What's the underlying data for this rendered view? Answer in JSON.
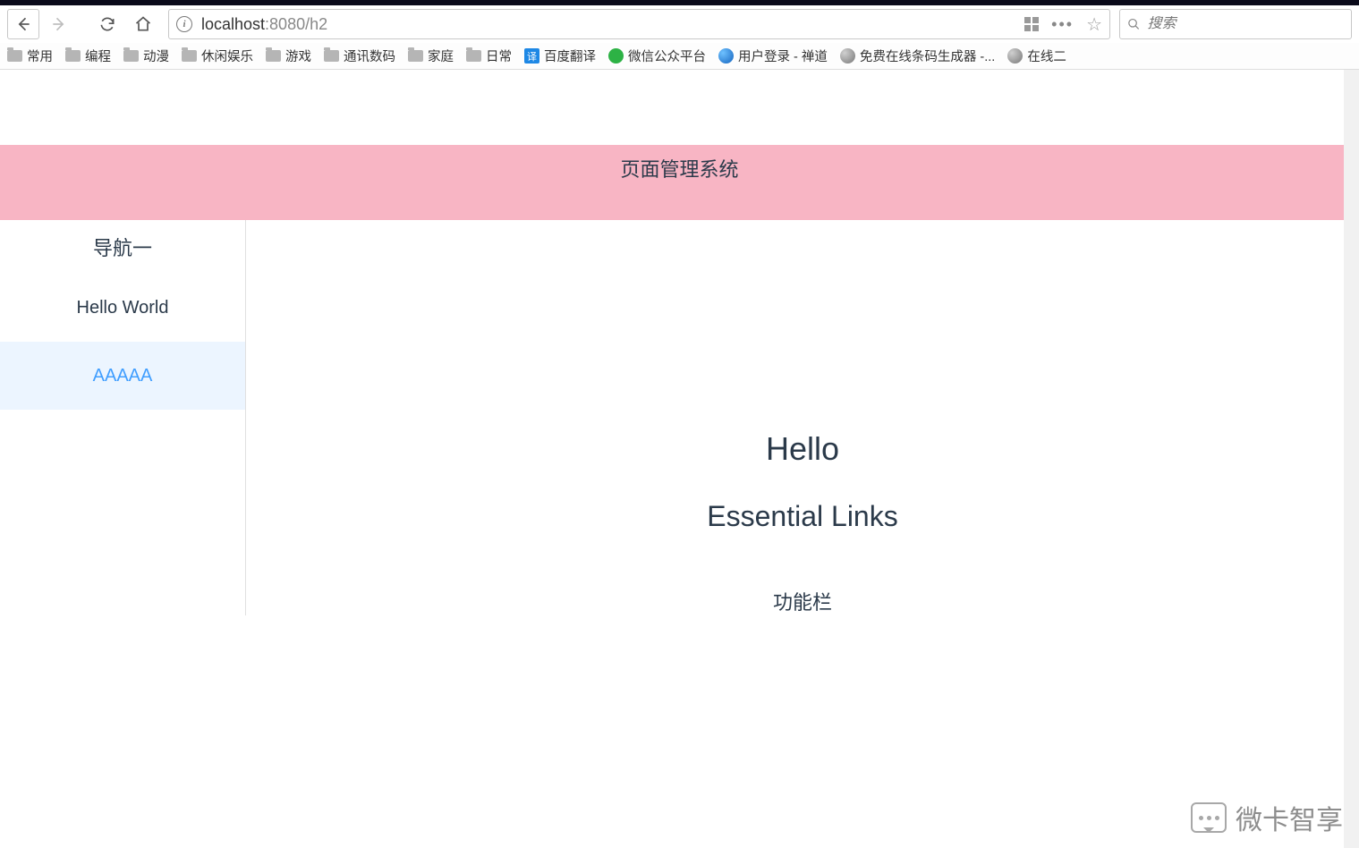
{
  "browser": {
    "url": {
      "host": "localhost",
      "port_path": ":8080/h2"
    },
    "search_placeholder": "搜索",
    "bookmarks": [
      {
        "kind": "folder",
        "label": "常用"
      },
      {
        "kind": "folder",
        "label": "编程"
      },
      {
        "kind": "folder",
        "label": "动漫"
      },
      {
        "kind": "folder",
        "label": "休闲娱乐"
      },
      {
        "kind": "folder",
        "label": "游戏"
      },
      {
        "kind": "folder",
        "label": "通讯数码"
      },
      {
        "kind": "folder",
        "label": "家庭"
      },
      {
        "kind": "folder",
        "label": "日常"
      },
      {
        "kind": "fav-blue",
        "label": "百度翻译",
        "badge": "译"
      },
      {
        "kind": "fav-green",
        "label": "微信公众平台"
      },
      {
        "kind": "fav-globe-blue",
        "label": "用户登录 - 禅道"
      },
      {
        "kind": "fav-globe-gray",
        "label": "免费在线条码生成器 -..."
      },
      {
        "kind": "fav-globe-gray",
        "label": "在线二"
      }
    ]
  },
  "page": {
    "header_title": "页面管理系统",
    "sidebar": {
      "title": "导航一",
      "items": [
        {
          "label": "Hello World",
          "active": false
        },
        {
          "label": "AAAAA",
          "active": true
        }
      ]
    },
    "content": {
      "heading1": "Hello",
      "heading2": "Essential Links",
      "heading3": "功能栏"
    }
  },
  "watermark": "微卡智享"
}
